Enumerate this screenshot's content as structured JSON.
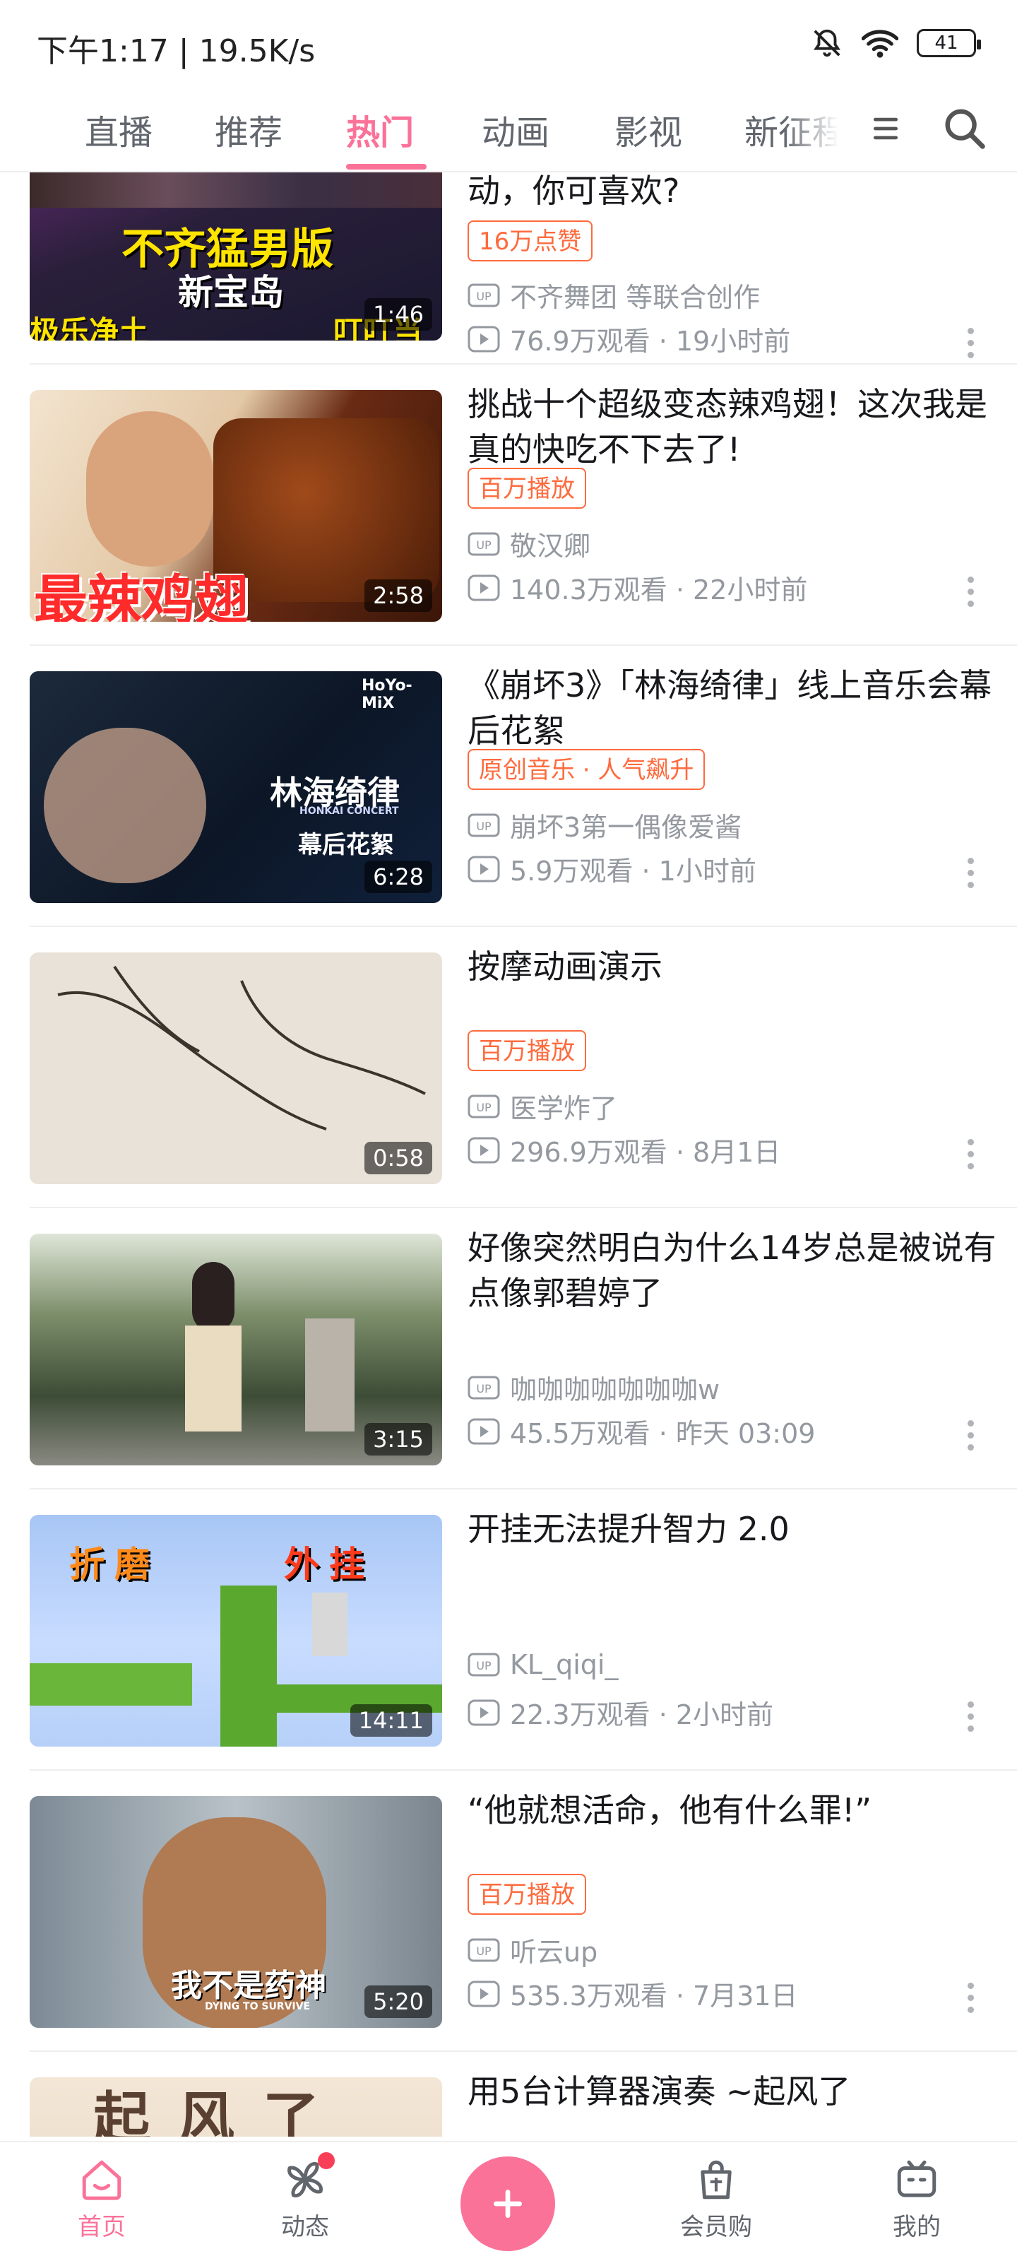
{
  "status": {
    "time": "下午1:17 | 19.5K/s",
    "battery": "41",
    "icons": [
      "bell-muted-icon",
      "wifi-icon",
      "battery-icon"
    ]
  },
  "tabs": [
    "直播",
    "推荐",
    "热门",
    "动画",
    "影视",
    "新征程"
  ],
  "active_tab": "热门",
  "colors": {
    "accent": "#fb7299",
    "badge": "#ff6a3d",
    "meta": "#9499a0"
  },
  "videos": [
    {
      "title": "动，你可喜欢?",
      "badge": "16万点赞",
      "up": "不齐舞团 等联合创作",
      "views": "76.9万观看 · 19小时前",
      "duration": "1:46",
      "thumb_text": [
        "不齐猛男版",
        "新宝岛",
        "极乐净土",
        "叮叮当当"
      ]
    },
    {
      "title": "挑战十个超级变态辣鸡翅！这次我是真的快吃不下去了!",
      "badge": "百万播放",
      "up": "敬汉卿",
      "views": "140.3万观看 · 22小时前",
      "duration": "2:58",
      "thumb_text": [
        "最辣鸡翅"
      ]
    },
    {
      "title": "《崩坏3》「林海绮律」线上音乐会幕后花絮",
      "badge": "原创音乐 · 人气飙升",
      "up": "崩坏3第一偶像爱酱",
      "views": "5.9万观看 · 1小时前",
      "duration": "6:28",
      "thumb_text": [
        "林海绮律",
        "幕后花絮",
        "HoYo-MiX",
        "HONKAI CONCERT"
      ]
    },
    {
      "title": "按摩动画演示",
      "badge": "百万播放",
      "up": "医学炸了",
      "views": "296.9万观看 · 8月1日",
      "duration": "0:58",
      "thumb_text": []
    },
    {
      "title": "好像突然明白为什么14岁总是被说有点像郭碧婷了",
      "badge": "",
      "up": "咖咖咖咖咖咖咖w",
      "views": "45.5万观看 · 昨天 03:09",
      "duration": "3:15",
      "thumb_text": []
    },
    {
      "title": "开挂无法提升智力 2.0",
      "badge": "",
      "up": "KL_qiqi_",
      "views": "22.3万观看 · 2小时前",
      "duration": "14:11",
      "thumb_text": [
        "折磨",
        "外挂"
      ]
    },
    {
      "title": "“他就想活命，他有什么罪!”",
      "badge": "百万播放",
      "up": "听云up",
      "views": "535.3万观看 · 7月31日",
      "duration": "5:20",
      "thumb_text": [
        "我不是药神",
        "DYING TO SURVIVE"
      ]
    },
    {
      "title": "用5台计算器演奏 ~起风了",
      "badge": "",
      "up": "",
      "views": "",
      "duration": "",
      "thumb_text": [
        "起风了"
      ]
    }
  ],
  "bottom_nav": [
    {
      "label": "首页",
      "icon": "home-icon"
    },
    {
      "label": "动态",
      "icon": "pinwheel-icon"
    },
    {
      "label": "",
      "icon": "plus-icon"
    },
    {
      "label": "会员购",
      "icon": "shopping-bag-icon"
    },
    {
      "label": "我的",
      "icon": "tv-icon"
    }
  ]
}
